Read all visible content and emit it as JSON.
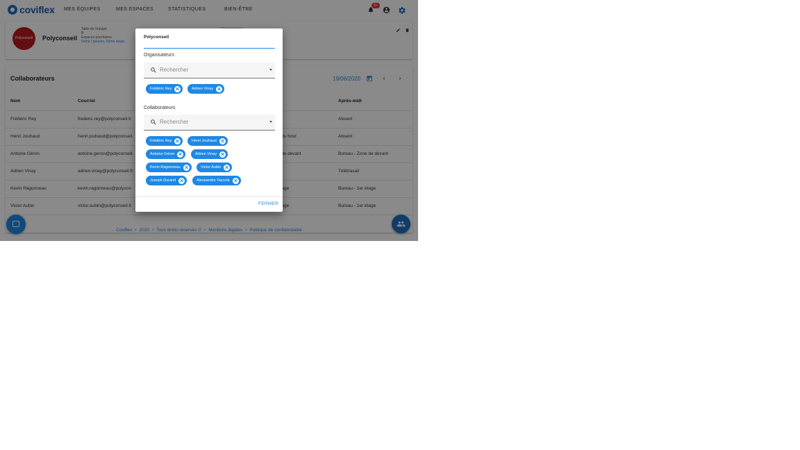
{
  "brand": {
    "name": "coviflex",
    "accent": "#1e88e5",
    "dark_accent": "#1e6fc4"
  },
  "nav": {
    "items": [
      "MES ÉQUIPES",
      "MES ESPACES",
      "STATISTIQUES",
      "BIEN-ÊTRE"
    ]
  },
  "notifications": {
    "count": "9+",
    "icon": "bell-icon"
  },
  "team": {
    "name": "Polyconseil",
    "logo_text": "Polyconseil",
    "size_label": "Taille de l'équipe",
    "size_value": "9",
    "spaces_label": "Espaces prioritaires",
    "spaces_value": "5ème / gauche, 5ème étage,",
    "organizers_label": "Organisateurs"
  },
  "collaborators_section": {
    "title": "Collaborateurs",
    "date": "19/06/2020",
    "columns": [
      "Nom",
      "Courriel",
      "Après-midi"
    ],
    "rows": [
      {
        "name": "Frédéric Rey",
        "email": "frederic.rey@polyconseil.fr",
        "morning": "",
        "afternoon": "Absent"
      },
      {
        "name": "Henri Jouhaud",
        "email": "henri.jouhaud@polyconseil.",
        "morning": "ne du fond",
        "afternoon": "Absent"
      },
      {
        "name": "Antoine Géron",
        "email": "antoine.geron@polyconseil.",
        "morning": "ne de devant",
        "afternoon": "Bureau - Zone de devant"
      },
      {
        "name": "Adrien Vinay",
        "email": "adrien.vinay@polyconseil.fr",
        "morning": "",
        "afternoon": "Télétravail"
      },
      {
        "name": "Kevin Ragonneau",
        "email": "kevin.ragonneau@polycon",
        "morning": "r étage",
        "afternoon": "Bureau - 1er étage"
      },
      {
        "name": "Victor Aubin",
        "email": "victor.aubin@polyconseil.fr",
        "morning": "r étage",
        "afternoon": "Bureau - 1er étage"
      }
    ]
  },
  "footer": {
    "items": [
      "Coviflex",
      "2020",
      "Tous droits réservés ©",
      "Mentions légales",
      "Politique de confidentialité"
    ]
  },
  "dialog": {
    "team_name": "Polyconseil",
    "organizers_label": "Organisateurs",
    "organizers_placeholder": "Rechercher",
    "organizers": [
      "Frédéric Rey",
      "Adrien Vinay"
    ],
    "collaborators_label": "Collaborateurs",
    "collaborators_placeholder": "Rechercher",
    "collaborators": [
      "Frédéric Rey",
      "Henri Jouhaud",
      "Antoine Géron",
      "Adrien Vinay",
      "Kevin Ragonneau",
      "Victor Aubin",
      "Joseph Durand",
      "Alessandro Taccola"
    ],
    "close_label": "FERMER"
  }
}
